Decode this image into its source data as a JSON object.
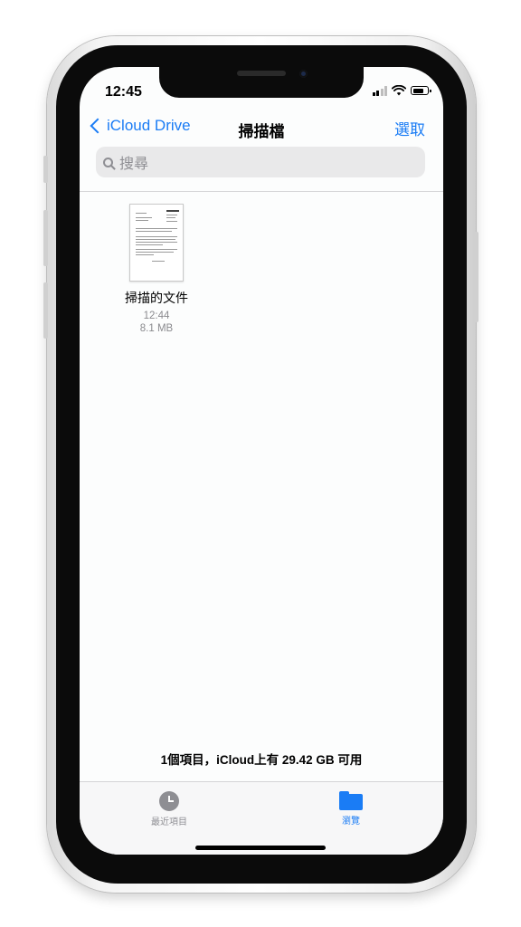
{
  "status_bar": {
    "time": "12:45"
  },
  "nav": {
    "back_label": "iCloud Drive",
    "title": "掃描檔",
    "select_label": "選取"
  },
  "search": {
    "placeholder": "搜尋"
  },
  "files": [
    {
      "name": "掃描的文件",
      "time": "12:44",
      "size": "8.1 MB"
    }
  ],
  "summary": "1個項目，iCloud上有 29.42 GB 可用",
  "tabbar": {
    "recent_label": "最近項目",
    "browse_label": "瀏覽",
    "active": "browse"
  },
  "colors": {
    "accent": "#1a7cf5",
    "inactive": "#8e8e93"
  },
  "icons": [
    "chevron-left-icon",
    "search-icon",
    "signal-icon",
    "wifi-icon",
    "battery-icon",
    "clock-icon",
    "folder-icon"
  ]
}
